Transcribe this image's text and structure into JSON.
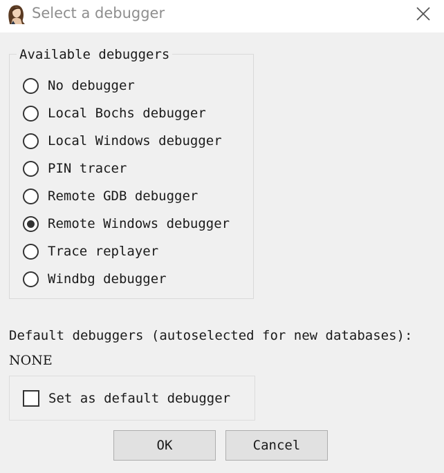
{
  "window": {
    "title": "Select a debugger",
    "icon": "ida-portrait-icon",
    "close_icon": "close-icon"
  },
  "debuggers": {
    "group_title": "Available debuggers",
    "options": [
      {
        "label": "No debugger",
        "checked": false
      },
      {
        "label": "Local Bochs debugger",
        "checked": false
      },
      {
        "label": "Local Windows debugger",
        "checked": false
      },
      {
        "label": "PIN tracer",
        "checked": false
      },
      {
        "label": "Remote GDB debugger",
        "checked": false
      },
      {
        "label": "Remote Windows debugger",
        "checked": true
      },
      {
        "label": "Trace replayer",
        "checked": false
      },
      {
        "label": "Windbg debugger",
        "checked": false
      }
    ]
  },
  "defaults": {
    "heading": "Default debuggers (autoselected for new databases):",
    "value": "NONE",
    "checkbox_label": "Set as default debugger",
    "checkbox_checked": false
  },
  "buttons": {
    "ok_label": "OK",
    "cancel_label": "Cancel"
  }
}
